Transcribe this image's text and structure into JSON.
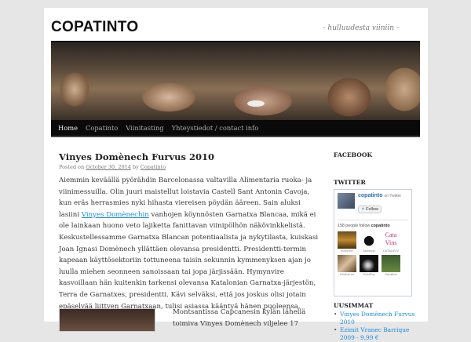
{
  "site": {
    "title": "COPATINTO",
    "tagline": "- hulluudesta viiniin -"
  },
  "nav": [
    "Home",
    "Copatinto",
    "Viinitasting",
    "Yhteystiedot / contact info"
  ],
  "post": {
    "title": "Vinyes Domènech Furvus 2010",
    "meta": {
      "prefix": "Posted on",
      "date": "October 30, 2014",
      "by": "by",
      "author": "Copatinto"
    },
    "lines": [
      "Aiemmin keväällä pyörähdin Barcelonassa valtavilla Alimentaria ruoka- ja",
      "viinimessuilla. Olin juuri maistellut loistavia Castell Sant Antonin Cavoja,",
      "kun eräs herrasmies nyki hihasta viereisen pöydän ääreen. Sain aluksi"
    ],
    "line4": {
      "pre": "lasiini",
      "link": "Vinyes Domènechin",
      "post": "vanhojen köynnösten Garnatxa Blancaa, mikä ei"
    },
    "lines2": [
      "ole lainkaan huono veto lajiketta fanittavan viinipölhön näkövinkkelistä.",
      "Keskustellessamme Garnatxa Blancan potentiaalista ja nykytilasta, kuiskasi",
      "Joan Ignasi Domènech yllättäen olevansa presidentti. Presidentti-termin",
      "kapeaan käyttösektoriin tottuneena taisin sekunnin kymmenyksen ajan jo",
      "luulla miehen seonneen sanoissaan tai jopa järjissään. Hymynvire",
      "kasvoillaan hän kuitenkin tarkensi olevansa Katalonian Garnatxa-järjestön,",
      "Terra de Garnatxes, presidentti. Kävi selväksi, että jos joskus olisi jotain",
      "epäselvää liittyen Garnatxaan, tulisi asiassa kääntyä hänen puoleensa."
    ],
    "p2": [
      "Montsantissa Capcanesin kylän lähellä",
      "toimiva Vinyes Domènech viljelee 17"
    ]
  },
  "sidebar": {
    "facebook": "FACEBOOK",
    "twitter": {
      "title": "TWITTER",
      "name": "copatinto",
      "on": "on Twitter",
      "follow": "Follow",
      "count_text": "158 people follow",
      "count_name": "copatinto",
      "followers": [
        "trumpein",
        "Akmbiqu",
        "CATADELV",
        "HValverou",
        "SoloRioj",
        "Hamilton"
      ]
    },
    "recent": {
      "title": "UUSIMMAT",
      "items": [
        "Vinyes Domènech Furvus 2010",
        "Ezimit Vranec Barrique 2009 - 9,99 €"
      ]
    }
  }
}
